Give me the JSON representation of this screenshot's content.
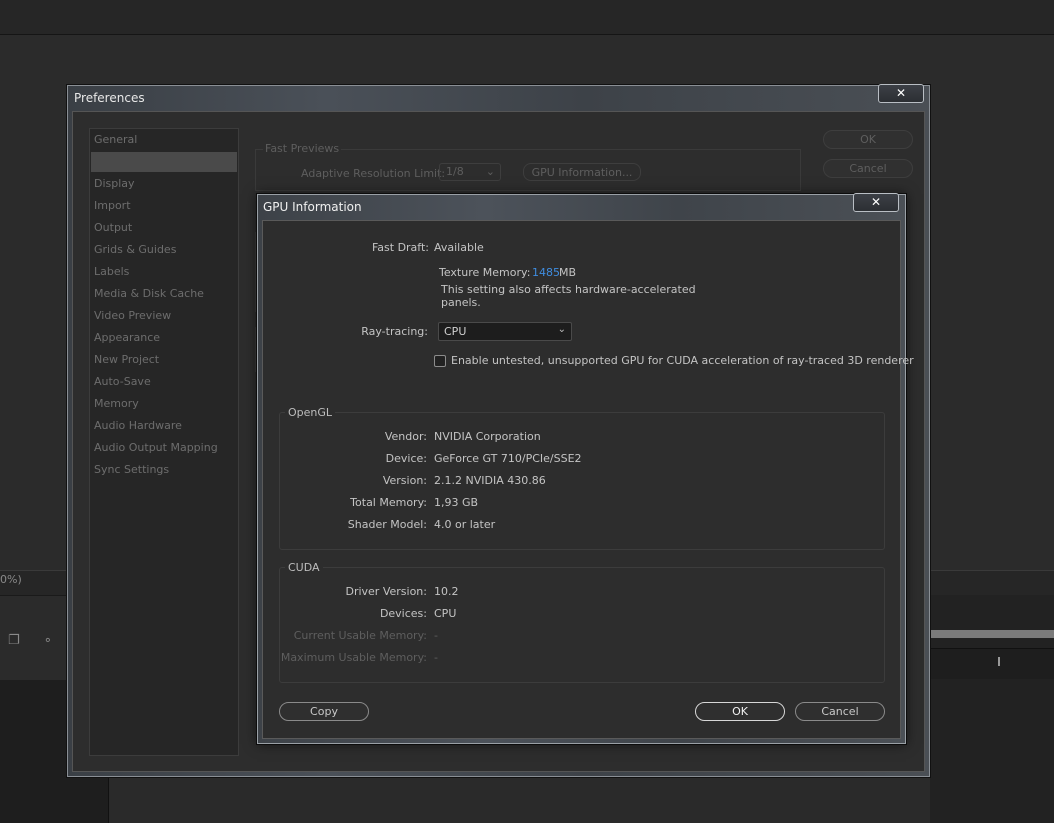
{
  "background_app": {
    "zoom_text": "0%)",
    "panel_icons": "❐ ∘"
  },
  "preferences": {
    "title": "Preferences",
    "close_label": "✕",
    "items": [
      {
        "label": "General"
      },
      {
        "label": ""
      },
      {
        "label": "Display"
      },
      {
        "label": "Import"
      },
      {
        "label": "Output"
      },
      {
        "label": "Grids & Guides"
      },
      {
        "label": "Labels"
      },
      {
        "label": "Media & Disk Cache"
      },
      {
        "label": "Video Preview"
      },
      {
        "label": "Appearance"
      },
      {
        "label": "New Project"
      },
      {
        "label": "Auto-Save"
      },
      {
        "label": "Memory"
      },
      {
        "label": "Audio Hardware"
      },
      {
        "label": "Audio Output Mapping"
      },
      {
        "label": "Sync Settings"
      }
    ],
    "fast_previews": {
      "group_label": "Fast Previews",
      "adaptive_label": "Adaptive Resolution Limit:",
      "adaptive_value": "1/8",
      "gpu_info_button": "GPU Information..."
    },
    "ok_label": "OK",
    "cancel_label": "Cancel"
  },
  "gpu_info": {
    "title": "GPU Information",
    "close_label": "✕",
    "fast_draft_label": "Fast Draft:",
    "fast_draft_value": "Available",
    "texture_memory_label": "Texture Memory:",
    "texture_memory_value": "1485",
    "texture_memory_unit": "MB",
    "note_line1": "This setting also affects hardware-accelerated",
    "note_line2": "panels.",
    "raytracing_label": "Ray-tracing:",
    "raytracing_value": "CPU",
    "checkbox_label": "Enable untested, unsupported GPU for CUDA acceleration of ray-traced 3D renderer",
    "checkbox_checked": false,
    "opengl": {
      "group_label": "OpenGL",
      "rows": [
        {
          "label": "Vendor:",
          "value": "NVIDIA Corporation"
        },
        {
          "label": "Device:",
          "value": "GeForce GT 710/PCIe/SSE2"
        },
        {
          "label": "Version:",
          "value": "2.1.2 NVIDIA 430.86"
        },
        {
          "label": "Total Memory:",
          "value": "1,93 GB"
        },
        {
          "label": "Shader Model:",
          "value": "4.0 or later"
        }
      ]
    },
    "cuda": {
      "group_label": "CUDA",
      "rows": [
        {
          "label": "Driver Version:",
          "value": "10.2"
        },
        {
          "label": "Devices:",
          "value": "CPU"
        },
        {
          "label": "Current Usable Memory:",
          "value": "-"
        },
        {
          "label": "Maximum Usable Memory:",
          "value": "-"
        }
      ]
    },
    "copy_label": "Copy",
    "ok_label": "OK",
    "cancel_label": "Cancel"
  }
}
